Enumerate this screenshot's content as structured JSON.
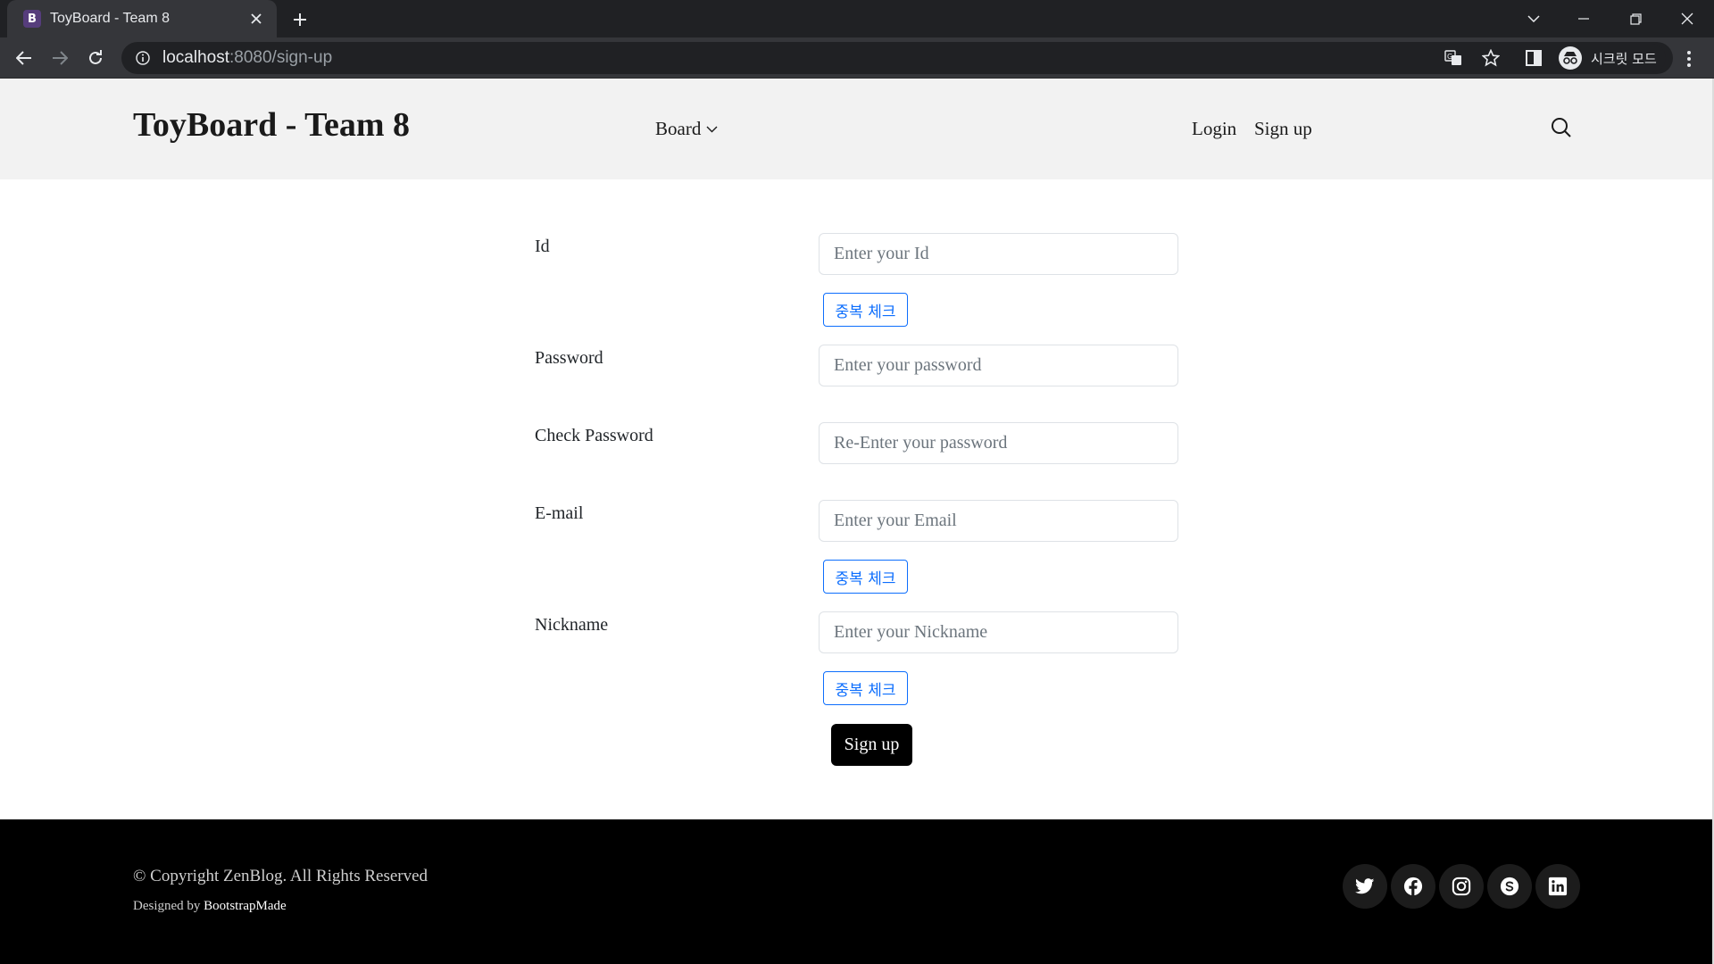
{
  "browser": {
    "tab_title": "ToyBoard - Team 8",
    "favicon_letter": "B",
    "url_host": "localhost",
    "url_path": ":8080/sign-up",
    "incognito_label": "시크릿 모드"
  },
  "header": {
    "brand": "ToyBoard - Team 8",
    "nav_board": "Board",
    "nav_login": "Login",
    "nav_signup": "Sign up"
  },
  "form": {
    "id_label": "Id",
    "id_placeholder": "Enter your Id",
    "password_label": "Password",
    "password_placeholder": "Enter your password",
    "check_password_label": "Check Password",
    "check_password_placeholder": "Re-Enter your password",
    "email_label": "E-mail",
    "email_placeholder": "Enter your Email",
    "nickname_label": "Nickname",
    "nickname_placeholder": "Enter your Nickname",
    "duplicate_check_label": "중복 체크",
    "submit_label": "Sign up"
  },
  "footer": {
    "copyright": "© Copyright ZenBlog. All Rights Reserved",
    "designed_by_prefix": "Designed by ",
    "designed_by_link": "BootstrapMade",
    "social_icons": [
      "twitter-icon",
      "facebook-icon",
      "instagram-icon",
      "skype-icon",
      "linkedin-icon"
    ]
  },
  "colors": {
    "header_bg": "#f2f2f2",
    "footer_bg": "#000000",
    "primary_blue": "#0d6efd",
    "submit_bg": "#000000"
  }
}
